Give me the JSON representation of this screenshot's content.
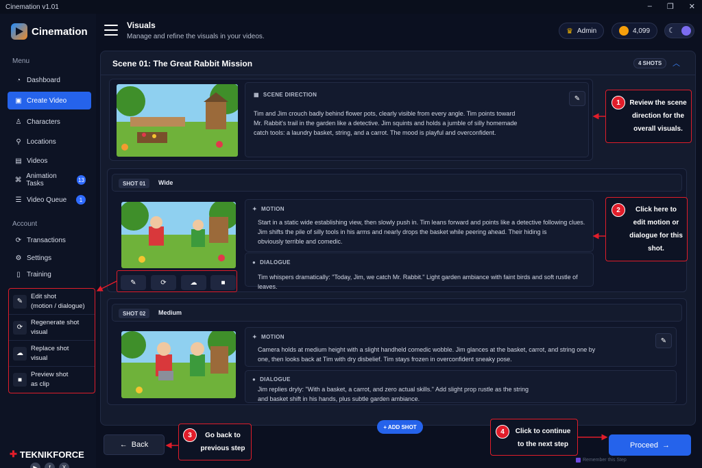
{
  "window": {
    "title": "Cinemation v1.01",
    "controls": [
      "–",
      "❐",
      "✕"
    ]
  },
  "sidebar": {
    "logo_text": "Cinemation",
    "menu_heading": "Menu",
    "items": [
      {
        "label": "Dashboard",
        "icon": "dashboard-icon",
        "glyph": "◔",
        "badge": "",
        "active": false
      },
      {
        "label": "Create Video",
        "icon": "create-video-icon",
        "glyph": "▣",
        "badge": "",
        "active": true
      },
      {
        "label": "Characters",
        "icon": "characters-icon",
        "glyph": "♙",
        "badge": "",
        "active": false
      },
      {
        "label": "Locations",
        "icon": "location-pin-icon",
        "glyph": "⚲",
        "badge": "",
        "active": false
      },
      {
        "label": "Videos",
        "icon": "videos-icon",
        "glyph": "▤",
        "badge": "",
        "active": false
      },
      {
        "label": "Animation Tasks",
        "icon": "animation-tasks-icon",
        "glyph": "⌘",
        "badge": "13",
        "active": false
      },
      {
        "label": "Video Queue",
        "icon": "video-queue-icon",
        "glyph": "☰",
        "badge": "1",
        "active": false
      }
    ],
    "account_heading": "Account",
    "account_items": [
      {
        "label": "Transactions",
        "icon": "transactions-icon",
        "glyph": "⟳"
      },
      {
        "label": "Settings",
        "icon": "gear-icon",
        "glyph": "⚙"
      },
      {
        "label": "Training",
        "icon": "training-icon",
        "glyph": "▯"
      }
    ],
    "tips": [
      {
        "line1": "Edit shot",
        "line2": "(motion / dialogue)",
        "icon": "pencil-icon",
        "glyph": "✎"
      },
      {
        "line1": "Regenerate shot",
        "line2": "visual",
        "icon": "refresh-icon",
        "glyph": "⟳"
      },
      {
        "line1": "Replace shot",
        "line2": "visual",
        "icon": "upload-cloud-icon",
        "glyph": "☁"
      },
      {
        "line1": "Preview shot",
        "line2": "as clip",
        "icon": "video-camera-icon",
        "glyph": "■"
      }
    ],
    "brand": "TEKNIKFORCE",
    "socials": [
      "▶",
      "f",
      "X"
    ]
  },
  "header": {
    "title": "Visuals",
    "subtitle": "Manage and refine the visuals in your videos.",
    "user_label": "Admin",
    "credits": "4,099"
  },
  "scene": {
    "title": "Scene 01: The Great Rabbit Mission",
    "shots_badge": "4 SHOTS",
    "direction_label": "SCENE DIRECTION",
    "direction_lines": [
      "Tim and Jim crouch badly behind flower pots, clearly visible from every angle. Tim points toward",
      "Mr. Rabbit's trail in the garden like a detective. Jim squints and holds a jumble of silly homemade",
      "catch tools: a laundry basket, string, and a carrot. The mood is playful and overconfident."
    ]
  },
  "shots": [
    {
      "chip": "SHOT 01",
      "type": "Wide",
      "motion_label": "MOTION",
      "motion_lines": [
        "Start in a static wide establishing view, then slowly push in. Tim leans forward and points like a detective following clues.",
        "Jim shifts the pile of silly tools in his arms and nearly drops the basket while peering ahead. Their hiding is",
        "obviously terrible and comedic."
      ],
      "dialogue_label": "DIALOGUE",
      "dialogue_lines": [
        "Tim whispers dramatically: \"Today, Jim, we catch Mr. Rabbit.\" Light garden ambiance with faint birds and soft rustle of leaves."
      ]
    },
    {
      "chip": "SHOT 02",
      "type": "Medium",
      "motion_label": "MOTION",
      "motion_lines": [
        "Camera holds at medium height with a slight handheld comedic wobble. Jim glances at the basket, carrot, and string one by",
        "one, then looks back at Tim with dry disbelief. Tim stays frozen in overconfident sneaky pose."
      ],
      "dialogue_label": "DIALOGUE",
      "dialogue_lines": [
        "Jim replies dryly: \"With a basket, a carrot, and zero actual skills.\" Add slight prop rustle as the string",
        "and basket shift in his hands, plus subtle garden ambiance."
      ]
    }
  ],
  "actions": {
    "add_shot": "+ ADD SHOT",
    "back": "Back",
    "proceed": "Proceed",
    "remember": "Remember this Step"
  },
  "callouts": [
    {
      "num": "1",
      "lines": [
        "Review the scene",
        "direction for the",
        "overall visuals."
      ]
    },
    {
      "num": "2",
      "lines": [
        "Click here to",
        "edit motion or",
        "dialogue for this",
        "shot."
      ]
    },
    {
      "num": "3",
      "lines": [
        "Go back to",
        "previous step"
      ]
    },
    {
      "num": "4",
      "lines": [
        "Click to continue",
        "to the next step"
      ]
    }
  ],
  "colors": {
    "accent": "#2563eb",
    "callout": "#e11d2a",
    "background": "#0b1020"
  }
}
